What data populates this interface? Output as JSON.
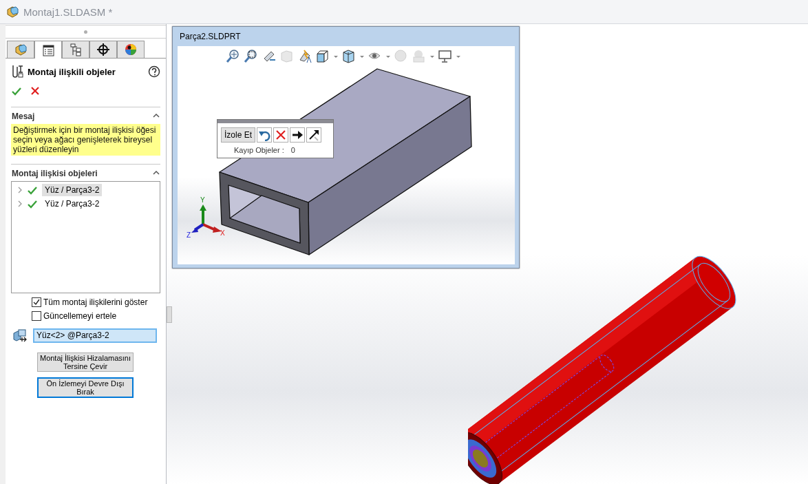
{
  "window": {
    "title": "Montaj1.SLDASM *"
  },
  "panel_tabs": [
    {
      "kind": "assembly",
      "selected": false
    },
    {
      "kind": "properties",
      "selected": true
    },
    {
      "kind": "config",
      "selected": false
    },
    {
      "kind": "dimxpert",
      "selected": false
    },
    {
      "kind": "display",
      "selected": false
    }
  ],
  "property_manager": {
    "title": "Montaj ilişkili objeler"
  },
  "message": {
    "heading": "Mesaj",
    "expanded": true,
    "text": "Değiştirmek için bir montaj ilişkisi öğesi seçin veya ağacı genişleterek bireysel yüzleri düzenleyin"
  },
  "objects_section": {
    "heading": "Montaj ilişkisi objeleri",
    "expanded": true,
    "items": [
      {
        "label": "Yüz / Parça3-2",
        "selected": true
      },
      {
        "label": "Yüz / Parça3-2",
        "selected": false
      }
    ]
  },
  "options": [
    {
      "label": "Tüm montaj ilişkilerini göster",
      "checked": true
    },
    {
      "label": "Güncellemeyi ertele",
      "checked": false
    }
  ],
  "face_field": {
    "value": "Yüz<2> @Parça3-2"
  },
  "buttons": [
    {
      "label": "Montaj İlişkisi Hizalamasını Tersine Çevir",
      "focused": false
    },
    {
      "label": "Ön İzlemeyi Devre Dışı Bırak",
      "focused": true
    }
  ],
  "preview_window": {
    "title": "Parça2.SLDPRT"
  },
  "isolate_toolbar": {
    "isolate_label": "İzole Et",
    "missing_label": "Kayıp Objeler :",
    "missing_count": "0"
  },
  "triad": {
    "x": "X",
    "y": "Y",
    "z": "Z"
  }
}
